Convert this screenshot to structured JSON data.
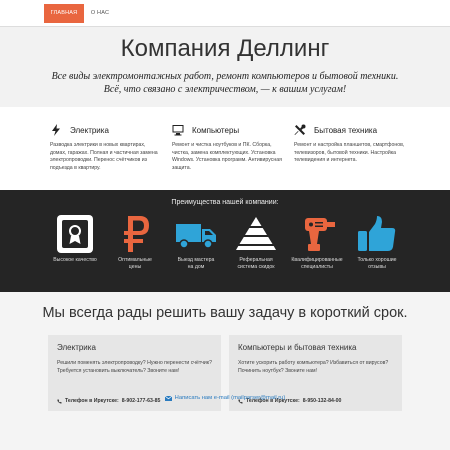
{
  "nav": {
    "items": [
      {
        "label": "Главная",
        "active": true
      },
      {
        "label": "О нас",
        "active": false
      }
    ],
    "accent_color": "#e9663f"
  },
  "hero": {
    "title": "Компания Деллинг",
    "subtitle_line1": "Все виды электромонтажных работ, ремонт компьютеров и бытовой техники.",
    "subtitle_line2": "Всё, что связано с электричеством, — к вашим услугам!"
  },
  "services": [
    {
      "icon": "bolt-icon",
      "title": "Электрика",
      "text": "Разводка электрики в новых квартирах, домах, гаражах. Полная и частичная замена электропроводки. Перенос счётчиков из подъезда в квартиру."
    },
    {
      "icon": "monitor-icon",
      "title": "Компьютеры",
      "text": "Ремонт и чистка ноутбуков и ПК. Сборка, чистка, замена комплектующих. Установка Windows. Установка программ. Антивирусная защита."
    },
    {
      "icon": "tools-icon",
      "title": "Бытовая техника",
      "text": "Ремонт и настройка планшетов, смартфонов, телевизоров, бытовой техники. Настройка телевидения и интернета."
    }
  ],
  "advantages": {
    "title": "Преимущества нашей компании:",
    "items": [
      {
        "icon": "certificate-icon",
        "label_line1": "Высокое качество",
        "label_line2": "",
        "color": "#ffffff"
      },
      {
        "icon": "ruble-icon",
        "label_line1": "Оптимальные",
        "label_line2": "цены",
        "color": "#e9663f"
      },
      {
        "icon": "truck-icon",
        "label_line1": "Выезд мастера",
        "label_line2": "на дом",
        "color": "#2fa4d8"
      },
      {
        "icon": "pyramid-icon",
        "label_line1": "Реферальная",
        "label_line2": "система скидок",
        "color": "#ffffff"
      },
      {
        "icon": "drill-icon",
        "label_line1": "Квалифицированные",
        "label_line2": "специалисты",
        "color": "#e9663f"
      },
      {
        "icon": "thumbs-up-icon",
        "label_line1": "Только хорошие",
        "label_line2": "отзывы",
        "color": "#2fa4d8"
      }
    ]
  },
  "contact": {
    "title": "Мы всегда рады решить вашу задачу в короткий срок.",
    "cards": [
      {
        "title": "Электрика",
        "text": "Решили поменять электропроводку? Нужно перенести счётчик? Требуется установить выключатель? Звоните нам!",
        "phone_label": "Телефон в Иркутске:",
        "phone": "8-902-177-63-85"
      },
      {
        "title": "Компьютеры и бытовая техника",
        "text": "Хотите ускорить работу компьютера? Избавиться от вирусов? Починить ноутбук? Звоните нам!",
        "phone_label": "Телефон в Иркутске:",
        "phone": "8-950-132-84-00"
      }
    ],
    "email_text": "Написать нам e-mail (mailparser@mail.ru)"
  }
}
